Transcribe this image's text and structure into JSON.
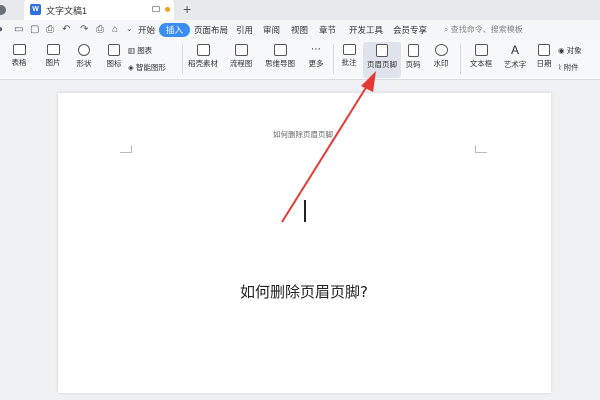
{
  "titlebar": {
    "doc_icon_letter": "W",
    "doc_title": "文字文稿1",
    "new_tab": "+"
  },
  "menu": {
    "tabs": [
      "开始",
      "插入",
      "页面布局",
      "引用",
      "审阅",
      "视图",
      "章节",
      "开发工具",
      "会员专享"
    ],
    "active_index": 1,
    "search_placeholder": "查找命令、搜索模板"
  },
  "ribbon": {
    "table": "表格",
    "picture": "图片",
    "shape": "形状",
    "icons": "图标",
    "chart": "图表",
    "smart_art": "智能图形",
    "stock": "稻壳素材",
    "flowchart": "流程图",
    "mindmap": "思维导图",
    "more": "更多",
    "comment": "批注",
    "header_footer": "页眉页脚",
    "page_number": "页码",
    "watermark": "水印",
    "textbox": "文本框",
    "wordart": "艺术字",
    "date": "日期",
    "object": "对象",
    "attachment": "附件"
  },
  "document": {
    "header_text": "如何删除页眉页脚",
    "body_heading": "如何删除页眉页脚?"
  },
  "colors": {
    "accent": "#3a8ef0",
    "arrow": "#e53935"
  }
}
